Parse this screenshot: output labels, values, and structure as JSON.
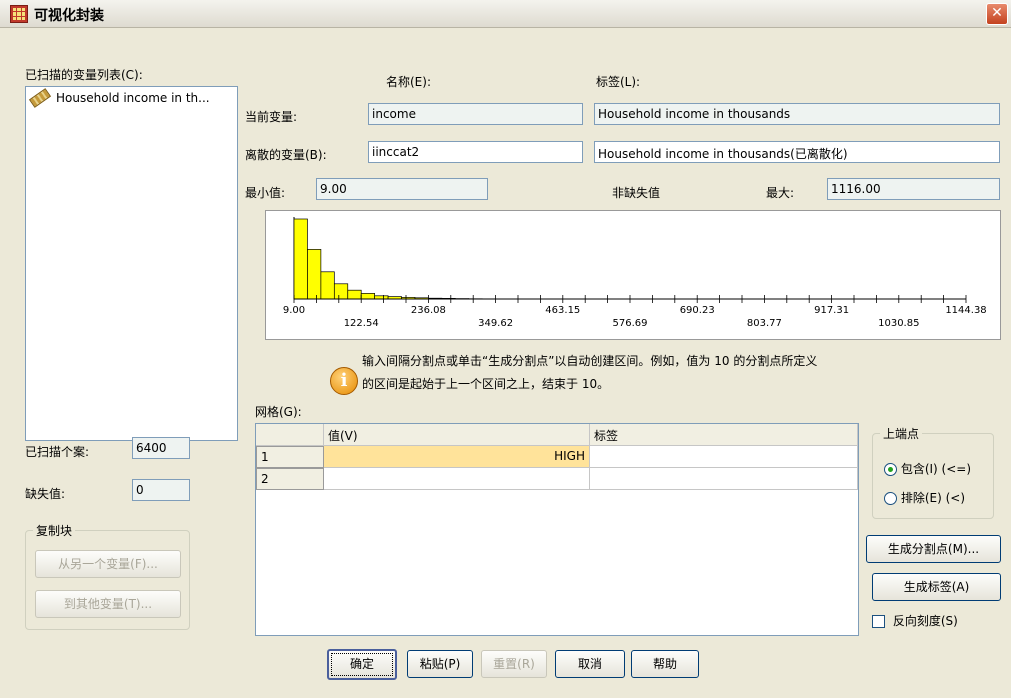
{
  "window": {
    "title": "可视化封装",
    "close_glyph": "✕"
  },
  "scanned_list": {
    "label": "已扫描的变量列表(C):",
    "items": [
      {
        "label": "Household income in th...",
        "icon": "ruler-icon"
      }
    ]
  },
  "columns": {
    "name_header": "名称(E):",
    "label_header": "标签(L):"
  },
  "current_var": {
    "label": "当前变量:",
    "name": "income",
    "var_label": "Household income in thousands"
  },
  "binned_var": {
    "label": "离散的变量(B):",
    "name": "iinccat2",
    "var_label": "Household income in thousands(已离散化)"
  },
  "min": {
    "label": "最小值:",
    "value": "9.00"
  },
  "nonmissing": {
    "label": "非缺失值"
  },
  "max": {
    "label": "最大:",
    "value": "1116.00"
  },
  "chart_data": {
    "type": "bar",
    "x_ticks_upper": [
      "9.00",
      "236.08",
      "463.15",
      "690.23",
      "917.31",
      "1144.38"
    ],
    "x_ticks_lower": [
      "122.54",
      "349.62",
      "576.69",
      "803.77",
      "1030.85"
    ],
    "xlim": [
      9.0,
      1144.38
    ],
    "bin_width": 22.71,
    "values": [
      100,
      62,
      34,
      19,
      11,
      7,
      4,
      3,
      2,
      1.5,
      1,
      0.8,
      0.5,
      0.3,
      0.2
    ],
    "bar_color": "#ffff00"
  },
  "info": {
    "line1": "输入间隔分割点或单击“生成分割点”以自动创建区间。例如，值为 10 的分割点所定义",
    "line2": "的区间是起始于上一个区间之上，结束于 10。"
  },
  "grid": {
    "label": "网格(G):",
    "headers": {
      "value": "值(V)",
      "label": "标签"
    },
    "rows": [
      {
        "num": "1",
        "value": "HIGH",
        "label": ""
      },
      {
        "num": "2",
        "value": "",
        "label": ""
      }
    ]
  },
  "cases_scanned": {
    "label": "已扫描个案:",
    "value": "6400"
  },
  "missing": {
    "label": "缺失值:",
    "value": "0"
  },
  "copy_block": {
    "title": "复制块",
    "from_button": "从另一个变量(F)...",
    "to_button": "到其他变量(T)..."
  },
  "upper_endpoint": {
    "title": "上端点",
    "include": "包含(I) (<=)",
    "exclude": "排除(E) (<)"
  },
  "buttons": {
    "make_cutpoints": "生成分割点(M)...",
    "make_labels": "生成标签(A)",
    "ok": "确定",
    "paste": "粘贴(P)",
    "reset": "重置(R)",
    "cancel": "取消",
    "help": "帮助"
  },
  "reverse_scale": {
    "label": "反向刻度(S)"
  }
}
